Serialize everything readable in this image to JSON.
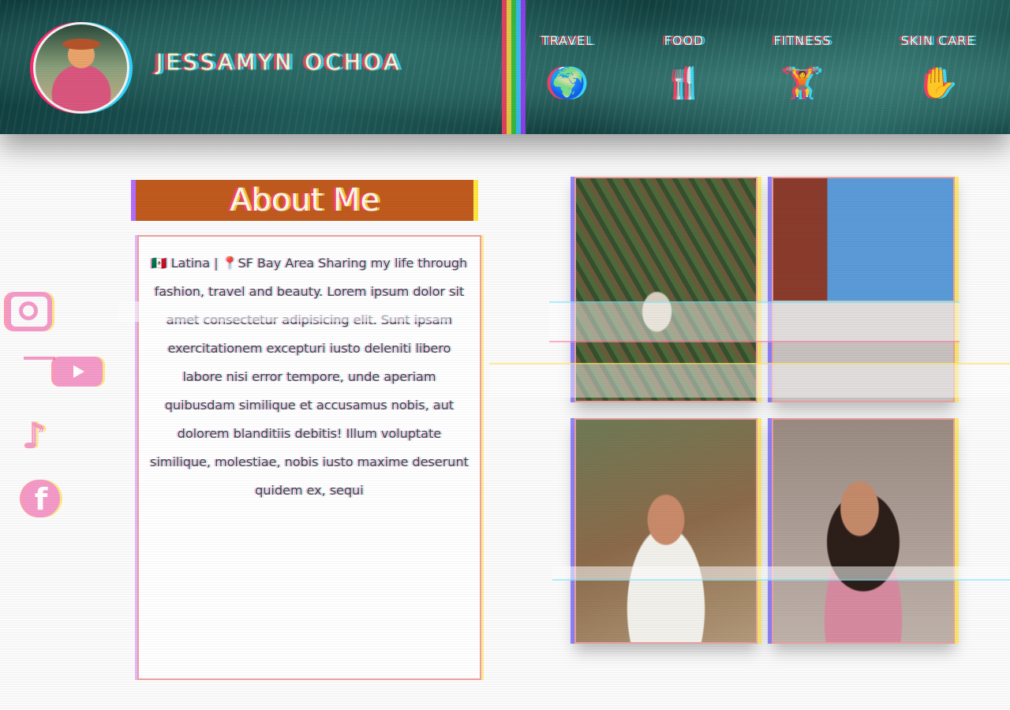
{
  "header": {
    "site_name": "JESSAMYN OCHOA",
    "nav": [
      {
        "label": "TRAVEL",
        "icon": "globe-icon",
        "glyph": "🌍"
      },
      {
        "label": "FOOD",
        "icon": "fork-knife-icon",
        "glyph": "🍴"
      },
      {
        "label": "FITNESS",
        "icon": "dumbbell-icon",
        "glyph": "🏋"
      },
      {
        "label": "SKIN CARE",
        "icon": "sparkle-hand-icon",
        "glyph": "✋"
      }
    ]
  },
  "social": [
    {
      "name": "instagram-icon"
    },
    {
      "name": "youtube-icon"
    },
    {
      "name": "tiktok-icon",
      "glyph": "♪"
    },
    {
      "name": "facebook-icon",
      "glyph": "f"
    }
  ],
  "about": {
    "title": "About Me",
    "text": "🇲🇽 Latina | 📍SF Bay Area Sharing my life through fashion, travel and beauty. Lorem ipsum dolor sit amet consectetur adipisicing elit. Sunt ipsam exercitationem excepturi iusto deleniti libero labore nisi error tempore, unde aperiam quibusdam similique et accusamus nobis, aut dolorem blanditiis debitis! Illum voluptate similique, molestiae, nobis iusto maxime deserunt quidem ex, sequi"
  },
  "colors": {
    "accent": "#c05a1e",
    "header_bg": "#1f5a58",
    "social_pink": "#f49ac8"
  }
}
